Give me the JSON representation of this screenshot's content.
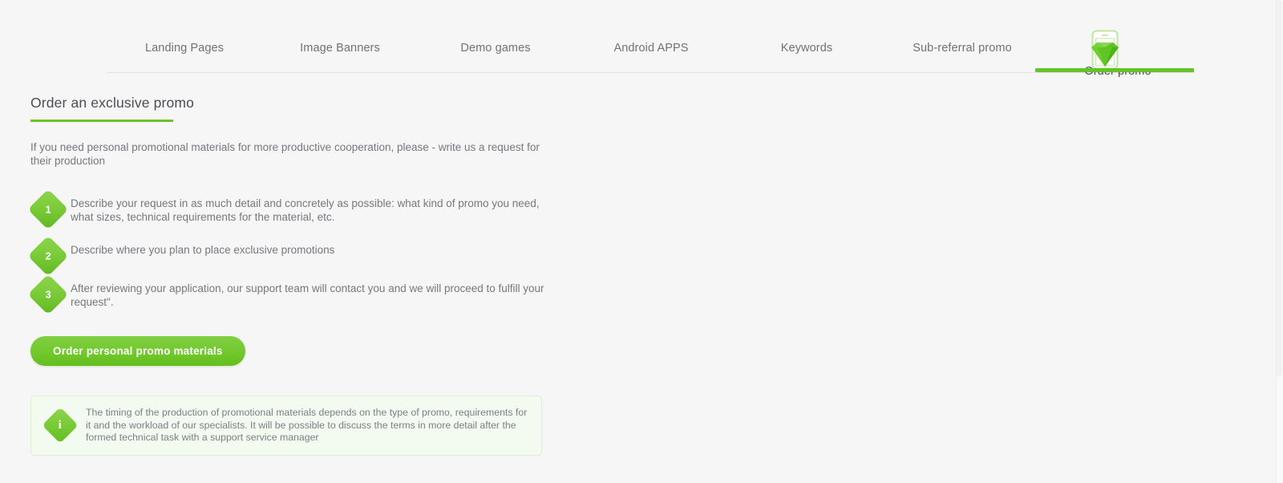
{
  "nav": {
    "tabs": [
      {
        "label": "Landing Pages",
        "active": false
      },
      {
        "label": "Image Banners",
        "active": false
      },
      {
        "label": "Demo games",
        "active": false
      },
      {
        "label": "Android APPS",
        "active": false
      },
      {
        "label": "Keywords",
        "active": false
      },
      {
        "label": "Sub-referral promo",
        "active": false
      },
      {
        "label": "Order promo",
        "active": true,
        "icon": "phone-diamond-icon"
      }
    ],
    "active_tab_label": "Order promo",
    "accent_color": "#66c229"
  },
  "main": {
    "title": "Order an exclusive promo",
    "intro": "If you need personal promotional materials for more productive cooperation, please - write us a request for their production",
    "steps": [
      {
        "number": "1",
        "text": "Describe your request in as much detail and concretely as possible: what kind of promo you need, what sizes, technical requirements for the material, etc."
      },
      {
        "number": "2",
        "text": "Describe where you plan to place exclusive promotions"
      },
      {
        "number": "3",
        "text": "After reviewing your application, our support team will contact you and we will proceed to fulfill your request\"."
      }
    ],
    "cta_label": "Order personal promo materials",
    "note": {
      "icon": "info-icon",
      "icon_glyph": "i",
      "text": "The timing of the production of promotional materials depends on the type of promo, requirements for it and the workload of our specialists. It will be possible to discuss the terms in more detail after the formed technical task with a support service manager"
    }
  },
  "theme": {
    "page_background": "#f6f6f6",
    "accent_green": "#6cc229",
    "button_green": "#73c92f",
    "note_background": "#f3faef",
    "note_border": "#ddeed2",
    "text_gray": "#75787d"
  }
}
